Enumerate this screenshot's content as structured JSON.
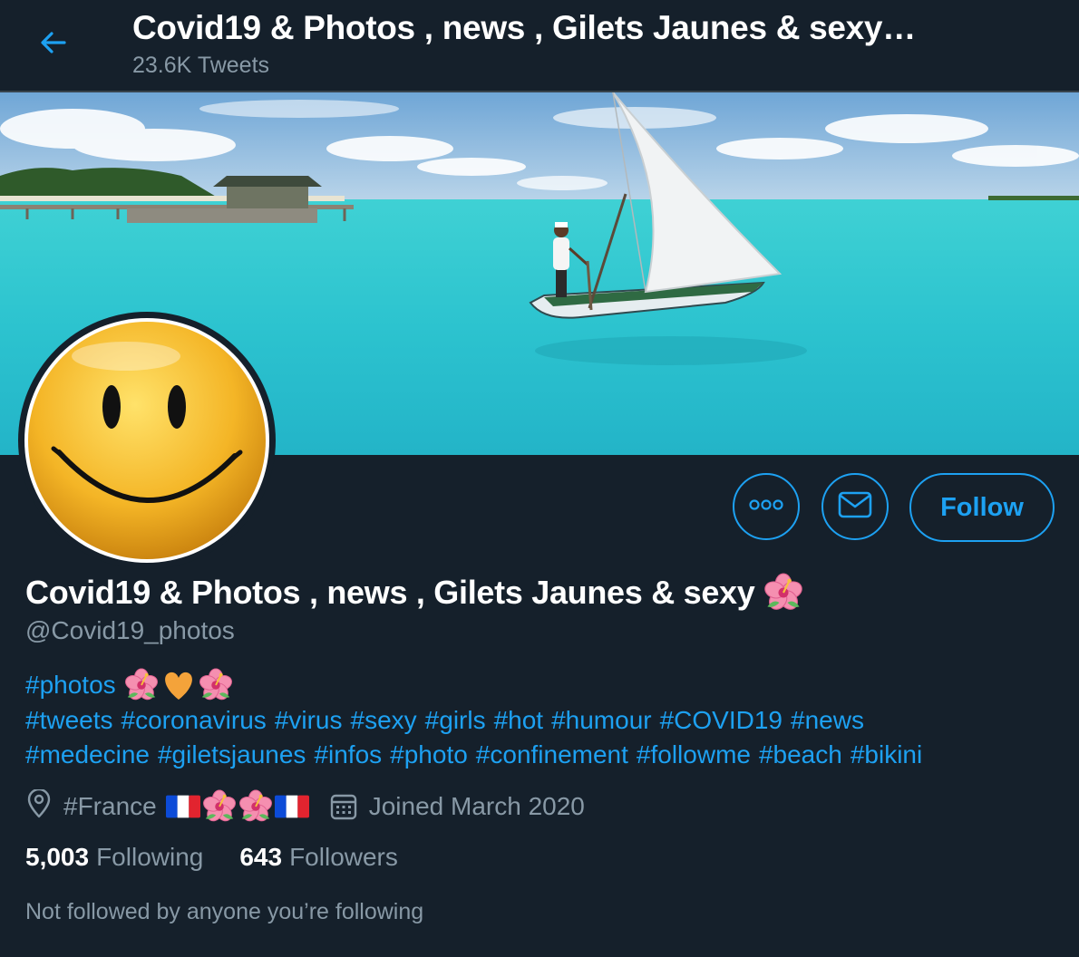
{
  "header": {
    "title": "Covid19 & Photos , news , Gilets Jaunes & sexy…",
    "tweet_count": "23.6K Tweets",
    "back_icon": "back-arrow-icon"
  },
  "banner": {
    "icon": "banner-image"
  },
  "avatar": {
    "icon": "smiley-face-avatar"
  },
  "actions": {
    "more_icon": "more-options-icon",
    "message_icon": "envelope-icon",
    "follow_label": "Follow"
  },
  "profile": {
    "display_name": "Covid19 & Photos , news , Gilets Jaunes & sexy",
    "handle": "@Covid19_photos",
    "bio_first_tag": "#photos",
    "bio_line2": [
      "#tweets",
      "#coronavirus",
      "#virus",
      "#sexy",
      "#girls",
      "#hot",
      "#humour",
      "#COVID19",
      "#news"
    ],
    "bio_line3": [
      "#medecine",
      "#giletsjaunes",
      "#infos",
      "#photo",
      "#confinement",
      "#followme",
      "#beach",
      "#bikini"
    ],
    "location": "#France",
    "joined": "Joined March 2020",
    "following_count": "5,003",
    "following_label": "Following",
    "followers_count": "643",
    "followers_label": "Followers",
    "not_followed": "Not followed by anyone you’re following"
  },
  "colors": {
    "background": "#15202b",
    "accent": "#1da1f2",
    "secondary_text": "#8899a6",
    "divider": "#38444d"
  }
}
